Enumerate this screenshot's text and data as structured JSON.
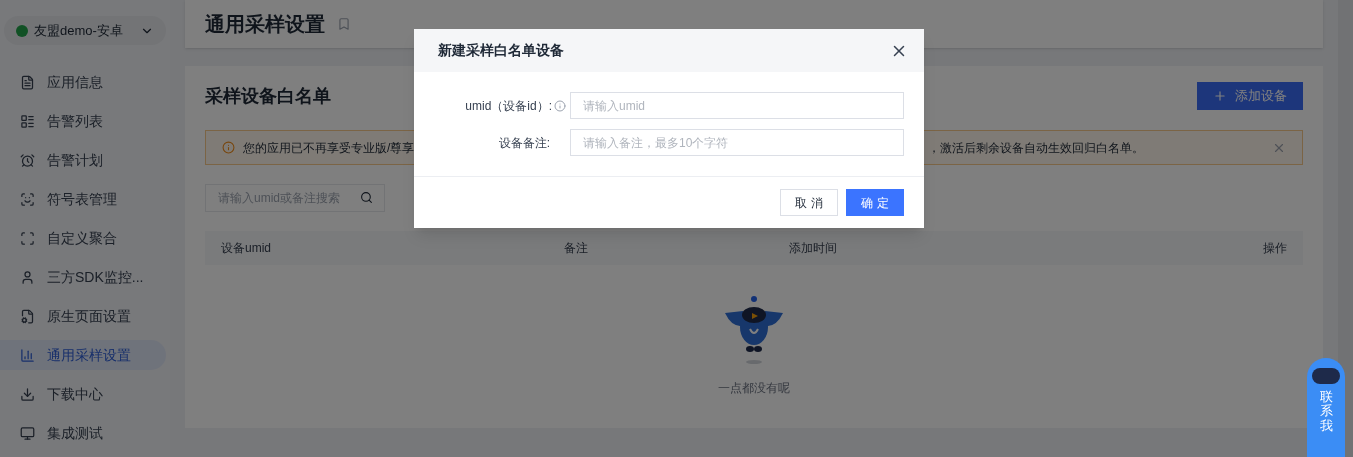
{
  "app_selector": {
    "label": "友盟demo-安卓"
  },
  "sidebar": {
    "items": [
      {
        "label": "应用信息",
        "selected": false
      },
      {
        "label": "告警列表",
        "selected": false
      },
      {
        "label": "告警计划",
        "selected": false
      },
      {
        "label": "符号表管理",
        "selected": false
      },
      {
        "label": "自定义聚合",
        "selected": false
      },
      {
        "label": "三方SDK监控...",
        "selected": false
      },
      {
        "label": "原生页面设置",
        "selected": false
      },
      {
        "label": "通用采样设置",
        "selected": true
      },
      {
        "label": "下载中心",
        "selected": false
      },
      {
        "label": "集成测试",
        "selected": false
      }
    ]
  },
  "page_title": "通用采样设置",
  "section": {
    "title": "采样设备白名单",
    "add_button": "添加设备",
    "alert": {
      "text_start": "您的应用已不再享受专业版/尊享",
      "text_end": "，激活后剩余设备自动生效回归白名单。"
    },
    "search": {
      "placeholder": "请输入umid或备注搜索"
    },
    "table": {
      "columns": [
        "设备umid",
        "备注",
        "添加时间",
        "操作"
      ]
    },
    "empty_text": "一点都没有呢"
  },
  "modal": {
    "title": "新建采样白名单设备",
    "fields": [
      {
        "label": "umid（设备id）:",
        "info": true,
        "placeholder": "请输入umid"
      },
      {
        "label": "设备备注:",
        "info": false,
        "placeholder": "请输入备注，最多10个字符"
      }
    ],
    "buttons": [
      {
        "label": "取 消",
        "kind": "secondary"
      },
      {
        "label": "确 定",
        "kind": "primary"
      }
    ]
  },
  "contact": {
    "label": "联系我"
  }
}
